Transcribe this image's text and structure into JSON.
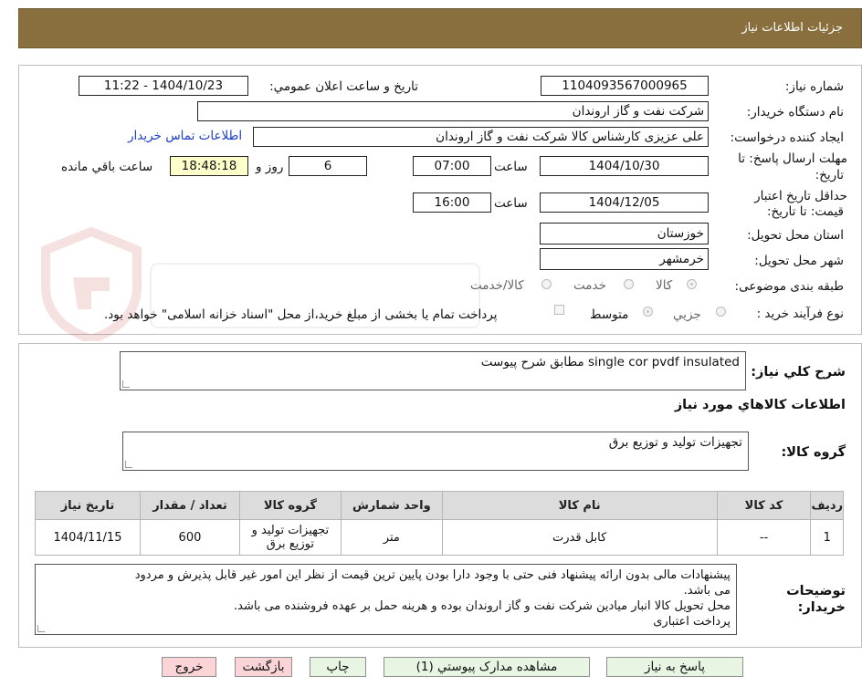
{
  "header": {
    "title": "جزئیات اطلاعات نیاز"
  },
  "info": {
    "need_number_label": "شماره نیاز:",
    "need_number": "1104093567000965",
    "announce_label": "تاریخ و ساعت اعلان عمومي:",
    "announce_value": "1404/10/23 - 11:22",
    "buyer_org_label": "نام دستگاه خریدار:",
    "buyer_org": "شرکت نفت و گاز اروندان",
    "requester_label": "ایجاد کننده درخواست:",
    "requester": "علی عزیزی کارشناس کالا شرکت نفت و گاز اروندان",
    "contact_link": "اطلاعات تماس خریدار",
    "deadline_label_1": "مهلت ارسال پاسخ: تا",
    "deadline_label_2": "تاریخ:",
    "deadline_date": "1404/10/30",
    "time_label": "ساعت",
    "deadline_time": "07:00",
    "days_value": "6",
    "days_label": "روز و",
    "remaining_time": "18:48:18",
    "remaining_label": "ساعت باقي مانده",
    "validity_label_1": "حداقل تاریخ اعتبار",
    "validity_label_2": "قیمت: تا تاریخ:",
    "validity_date": "1404/12/05",
    "validity_time": "16:00",
    "province_label": "استان محل تحویل:",
    "province": "خوزستان",
    "city_label": "شهر محل تحویل:",
    "city": "خرمشهر",
    "category_label": "طبقه بندی موضوعی:",
    "category_options": [
      "کالا",
      "خدمت",
      "کالا/خدمت"
    ],
    "process_label": "نوع فرآیند خرید :",
    "process_options": [
      "جزیي",
      "متوسط"
    ],
    "payment_note": "پرداخت تمام یا بخشی از مبلغ خرید،از محل \"اسناد خزانه اسلامی\" خواهد بود."
  },
  "details": {
    "general_desc_label": "شرح کلي نياز:",
    "general_desc": "single cor pvdf insulated مطابق شرح پیوست",
    "goods_section_title": "اطلاعات کالاهاي مورد نياز",
    "goods_group_label": "گروه کالا:",
    "goods_group": "تجهیزات تولید و توزیع برق",
    "table": {
      "headers": [
        "رديف",
        "کد کالا",
        "نام کالا",
        "واحد شمارش",
        "گروه کالا",
        "تعداد / مقدار",
        "تاريخ نياز"
      ],
      "rows": [
        [
          "1",
          "--",
          "کابل قدرت",
          "متر",
          "تجهیزات تولید و توزیع برق",
          "600",
          "1404/11/15"
        ]
      ]
    },
    "buyer_notes_label_1": "توضیحات",
    "buyer_notes_label_2": "خریدار:",
    "buyer_notes": [
      "پیشنهادات مالی بدون ارائه پیشنهاد فنی حتی با وجود دارا بودن پایین ترین قیمت از نظر این امور غیر قابل پذیرش و مردود",
      "می باشد.",
      "محل تحویل کالا انبار میادین شرکت نفت و گاز اروندان بوده و هرینه حمل بر عهده فروشنده می باشد.",
      "پرداخت اعتباری"
    ]
  },
  "buttons": {
    "reply": "پاسخ به نیاز",
    "attachments": "مشاهده مدارک پیوستي (1)",
    "print": "چاپ",
    "back": "بازگشت",
    "exit": "خروج"
  },
  "colors": {
    "header_bg": "#8a6f3e",
    "link": "#1a3ec8",
    "highlight": "#ffffcc",
    "button_green": "#e7f5e2",
    "button_pink": "#fbd4d8"
  }
}
